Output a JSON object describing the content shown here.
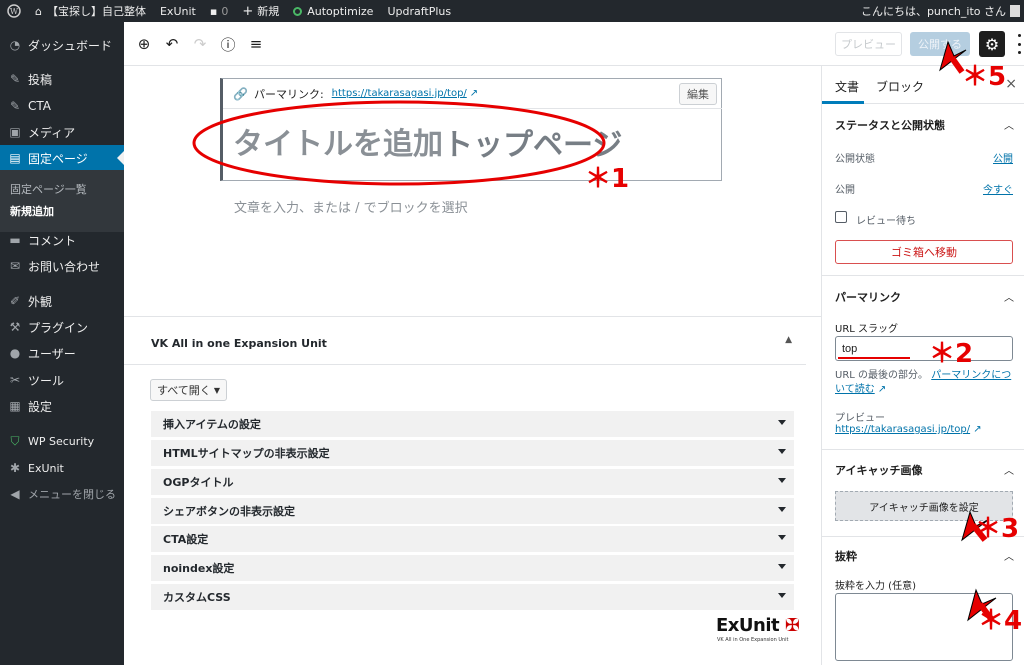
{
  "adminbar": {
    "site_name": "【宝探し】自己整体",
    "items": [
      "ExUnit",
      "0",
      "新規",
      "Autoptimize",
      "UpdraftPlus"
    ],
    "greeting": "こんにちは、punch_ito さん"
  },
  "sidebar": {
    "items": [
      {
        "label": "ダッシュボード",
        "icon": "gauge-icon"
      },
      {
        "label": "投稿",
        "icon": "pin-icon"
      },
      {
        "label": "CTA",
        "icon": "pin-icon"
      },
      {
        "label": "メディア",
        "icon": "media-icon"
      },
      {
        "label": "固定ページ",
        "icon": "page-icon"
      },
      {
        "label": "コメント",
        "icon": "comment-icon"
      },
      {
        "label": "お問い合わせ",
        "icon": "mail-icon"
      },
      {
        "label": "外観",
        "icon": "brush-icon"
      },
      {
        "label": "プラグイン",
        "icon": "plugin-icon"
      },
      {
        "label": "ユーザー",
        "icon": "user-icon"
      },
      {
        "label": "ツール",
        "icon": "wrench-icon"
      },
      {
        "label": "設定",
        "icon": "settings-icon"
      },
      {
        "label": "WP Security",
        "icon": "shield-icon"
      },
      {
        "label": "ExUnit",
        "icon": "gear-icon"
      },
      {
        "label": "メニューを閉じる",
        "icon": "collapse-icon"
      }
    ],
    "submenu": [
      "固定ページ一覧",
      "新規追加"
    ]
  },
  "toolbar": {
    "preview": "プレビュー",
    "publish": "公開する"
  },
  "editor": {
    "permalink_label": "パーマリンク:",
    "permalink_url": "https://takarasagasi.jp/top/",
    "edit_button": "編集",
    "title_placeholder": "タイトルを追加",
    "typed_title": "トップページ",
    "body_placeholder": "文章を入力、または / でブロックを選択"
  },
  "metabox": {
    "title": "VK All in one Expansion Unit",
    "open_all": "すべて開く",
    "rows": [
      "挿入アイテムの設定",
      "HTMLサイトマップの非表示設定",
      "OGPタイトル",
      "シェアボタンの非表示設定",
      "CTA設定",
      "noindex設定",
      "カスタムCSS"
    ],
    "logo": "ExUnit",
    "logo_sub": "VK All in One Expansion Unit"
  },
  "panel": {
    "tabs": [
      "文書",
      "ブロック"
    ],
    "status_section": "ステータスと公開状態",
    "visibility_label": "公開状態",
    "visibility_value": "公開",
    "publish_label": "公開",
    "publish_value": "今すぐ",
    "pending_label": "レビュー待ち",
    "trash_button": "ゴミ箱へ移動",
    "permalink_section": "パーマリンク",
    "slug_label": "URL スラッグ",
    "slug_value": "top",
    "slug_help": "URL の最後の部分。",
    "slug_help_link": "パーマリンクについて読む",
    "preview_label": "プレビュー",
    "preview_url": "https://takarasagasi.jp/top/",
    "featured_section": "アイキャッチ画像",
    "featured_button": "アイキャッチ画像を設定",
    "excerpt_section": "抜粋",
    "excerpt_label": "抜粋を入力 (任意)"
  },
  "annotations": [
    "＊1",
    "＊2",
    "＊3",
    "＊4",
    "＊5"
  ],
  "colors": {
    "admin_bg": "#23282d",
    "accent": "#0073aa",
    "annotation": "#e60000"
  }
}
